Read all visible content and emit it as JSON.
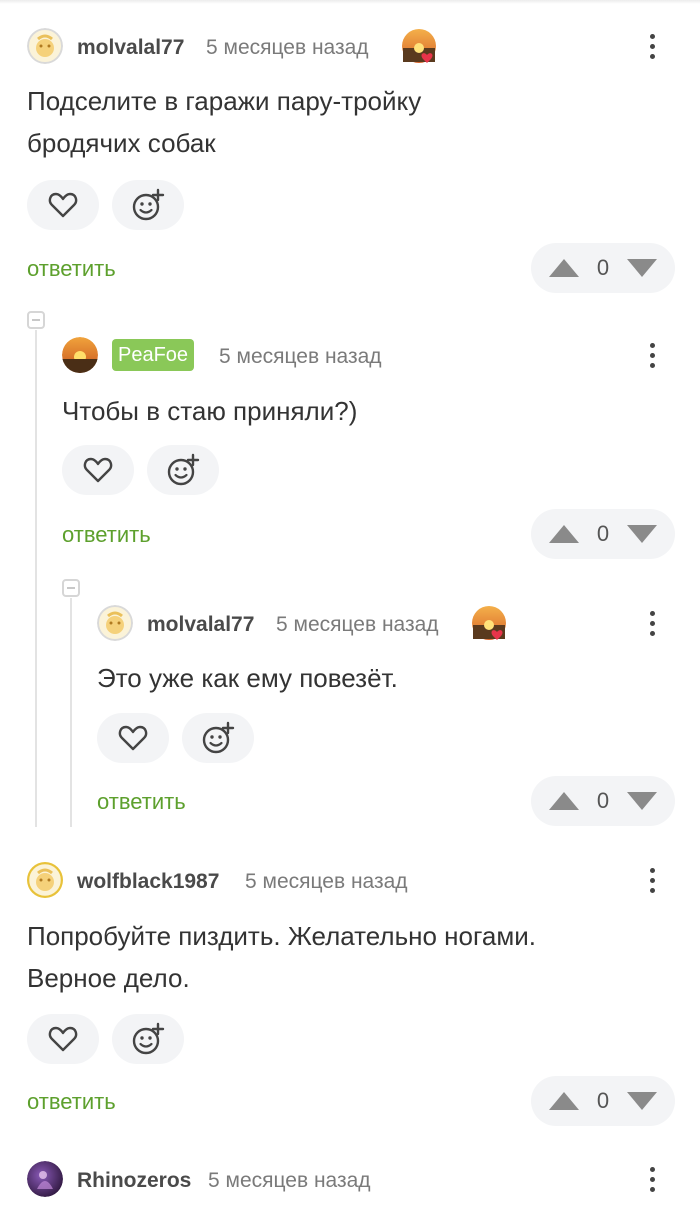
{
  "comments": [
    {
      "username": "molvalal77",
      "time": "5 месяцев назад",
      "text_lines": [
        "Подселите в гаражи пару-тройку",
        "бродячих собак"
      ],
      "reply_label": "ответить",
      "votes": "0",
      "avatar_icon": "avatar-yellow-face-icon",
      "award_icon": "sunset-heart-award-icon"
    },
    {
      "username": "PeaFoe",
      "time": "5 месяцев назад",
      "text_lines": [
        "Чтобы в стаю приняли?)"
      ],
      "reply_label": "ответить",
      "votes": "0",
      "avatar_icon": "avatar-sunset-icon",
      "badge_color": "#8ac858"
    },
    {
      "username": "molvalal77",
      "time": "5 месяцев назад",
      "text_lines": [
        "Это уже как ему повезёт."
      ],
      "reply_label": "ответить",
      "votes": "0",
      "avatar_icon": "avatar-yellow-face-icon",
      "award_icon": "sunset-heart-award-icon"
    },
    {
      "username": "wolfblack1987",
      "time": "5 месяцев назад",
      "text_lines": [
        "Попробуйте пиздить. Желательно ногами.",
        "Верное дело."
      ],
      "reply_label": "ответить",
      "votes": "0",
      "avatar_icon": "avatar-yellow-face-icon"
    },
    {
      "username": "Rhinozeros",
      "time": "5 месяцев назад",
      "avatar_icon": "avatar-purple-icon"
    }
  ],
  "colors": {
    "accent_green": "#5da02d",
    "badge_green": "#8ac858",
    "pill_bg": "#f3f4f6",
    "text": "#333333",
    "muted": "#7a7a7a"
  }
}
